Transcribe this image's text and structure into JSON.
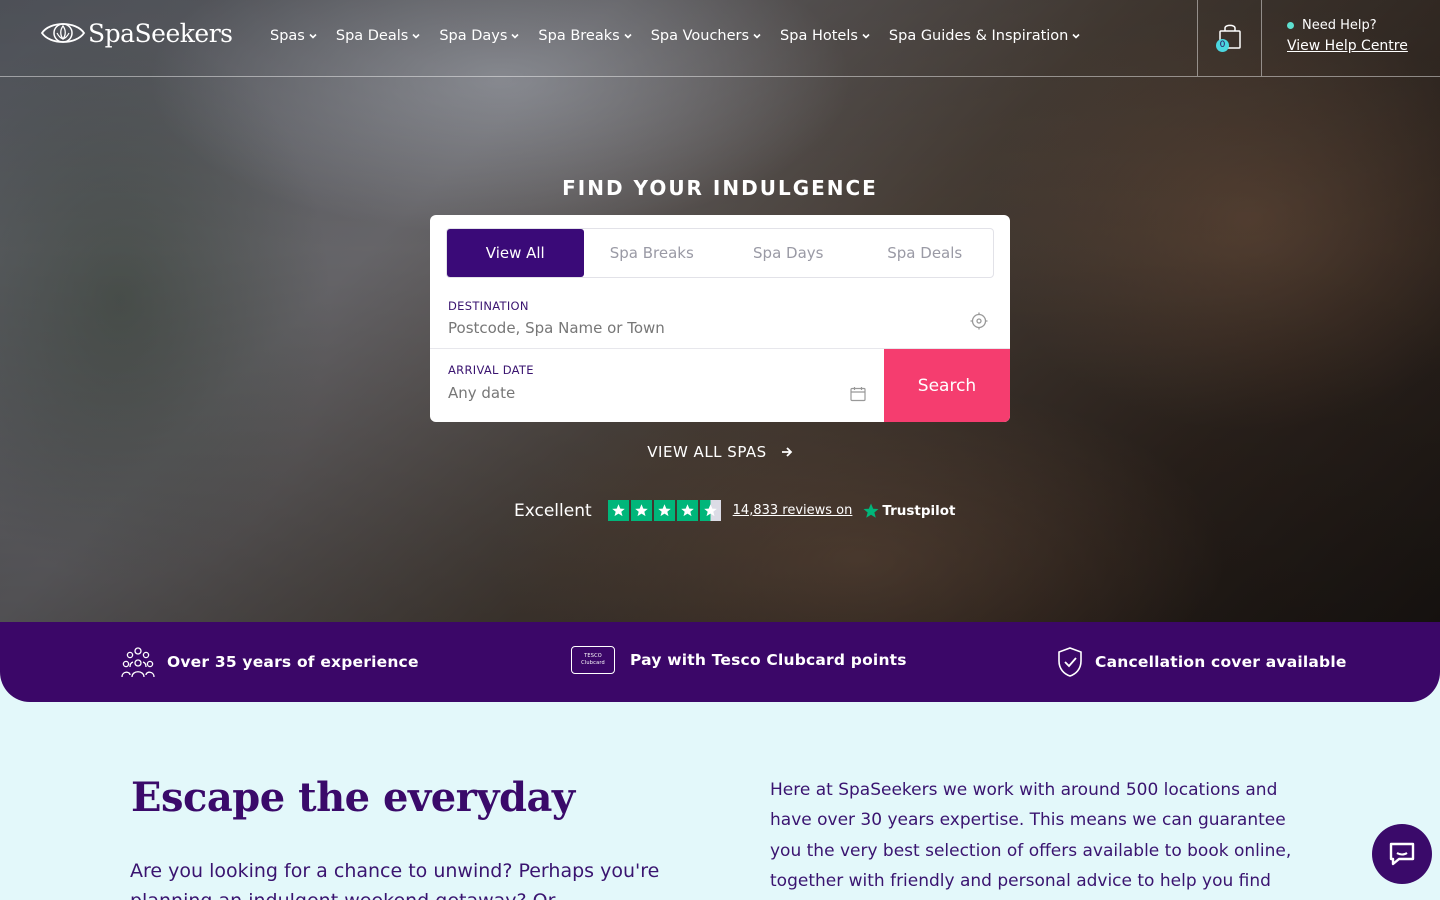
{
  "brand": {
    "name": "SpaSeekers"
  },
  "nav": {
    "items": [
      {
        "label": "Spas"
      },
      {
        "label": "Spa Deals"
      },
      {
        "label": "Spa Days"
      },
      {
        "label": "Spa Breaks"
      },
      {
        "label": "Spa Vouchers"
      },
      {
        "label": "Spa Hotels"
      },
      {
        "label": "Spa Guides & Inspiration"
      }
    ]
  },
  "cart": {
    "count": "0"
  },
  "help": {
    "label": "Need Help?",
    "link": "View Help Centre"
  },
  "hero": {
    "title": "FIND YOUR INDULGENCE"
  },
  "search": {
    "tabs": [
      {
        "label": "View All",
        "active": true
      },
      {
        "label": "Spa Breaks",
        "active": false
      },
      {
        "label": "Spa Days",
        "active": false
      },
      {
        "label": "Spa Deals",
        "active": false
      }
    ],
    "destination_label": "DESTINATION",
    "destination_placeholder": "Postcode, Spa Name or Town",
    "date_label": "ARRIVAL DATE",
    "date_placeholder": "Any date",
    "button_label": "Search"
  },
  "view_all": {
    "label": "VIEW ALL SPAS"
  },
  "trustpilot": {
    "rating_word": "Excellent",
    "stars": 4.5,
    "reviews_text": "14,833 reviews on",
    "brand": "Trustpilot"
  },
  "usps": [
    {
      "label": "Over 35 years of experience",
      "icon": "people-group-icon"
    },
    {
      "label": "Pay with Tesco Clubcard points",
      "icon": "tesco-clubcard-icon",
      "card_line1": "TESCO",
      "card_line2": "Clubcard"
    },
    {
      "label": "Cancellation cover available",
      "icon": "shield-check-icon"
    }
  ],
  "content": {
    "title": "Escape the everyday",
    "left_text": "Are you looking for a chance to unwind? Perhaps you're planning an indulgent weekend getaway? Or",
    "right_text": "Here at SpaSeekers we work with around 500 locations and have over 30 years expertise. This means we can guarantee you the very best selection of offers available to book online, together with friendly and personal advice to help you find"
  },
  "colors": {
    "primary": "#3b0768",
    "accent": "#f53d6f",
    "background": "#e3f8fa",
    "trustpilot_green": "#00b67a"
  }
}
